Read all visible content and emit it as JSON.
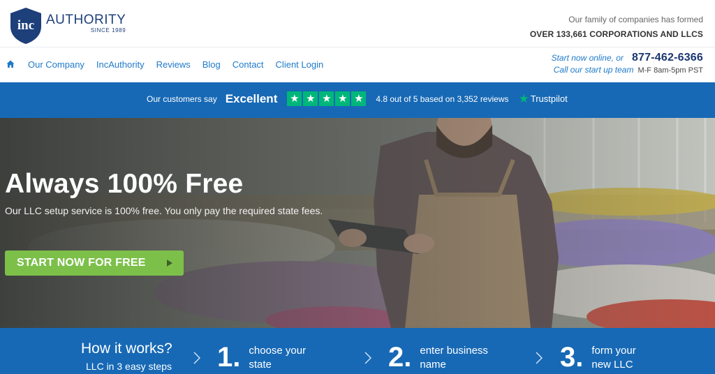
{
  "logo": {
    "badge": "inc",
    "word": "AUTHORITY",
    "since": "SINCE 1989"
  },
  "header": {
    "family_line1": "Our family of companies has formed",
    "family_line2": "OVER 133,661 CORPORATIONS AND LLCS"
  },
  "nav": {
    "home_icon": "home-icon",
    "links": [
      "Our Company",
      "IncAuthority",
      "Reviews",
      "Blog",
      "Contact",
      "Client Login"
    ]
  },
  "contact": {
    "start_online": "Start now online, or",
    "phone": "877-462-6366",
    "call_team": "Call our start up team",
    "hours": "M-F 8am-5pm PST"
  },
  "trust": {
    "say": "Our customers say",
    "rating_word": "Excellent",
    "stars": 5,
    "rating_text": "4.8 out of 5 based on 3,352 reviews",
    "brand": "Trustpilot",
    "star_color": "#00b67a"
  },
  "hero": {
    "title": "Always 100% Free",
    "subtitle": "Our LLC setup service is 100% free. You only pay the required state fees.",
    "cta_label": "START NOW FOR FREE",
    "cta_color": "#7cc04a"
  },
  "steps": {
    "how_title": "How it works?",
    "how_sub": "LLC in 3 easy steps",
    "items": [
      {
        "num": "1.",
        "line1": "choose your",
        "line2": "state"
      },
      {
        "num": "2.",
        "line1": "enter business",
        "line2": "name"
      },
      {
        "num": "3.",
        "line1": "form your",
        "line2": "new LLC"
      }
    ]
  },
  "colors": {
    "brand_blue": "#1769b5",
    "navy": "#1a3770",
    "link": "#1f7ac9"
  }
}
